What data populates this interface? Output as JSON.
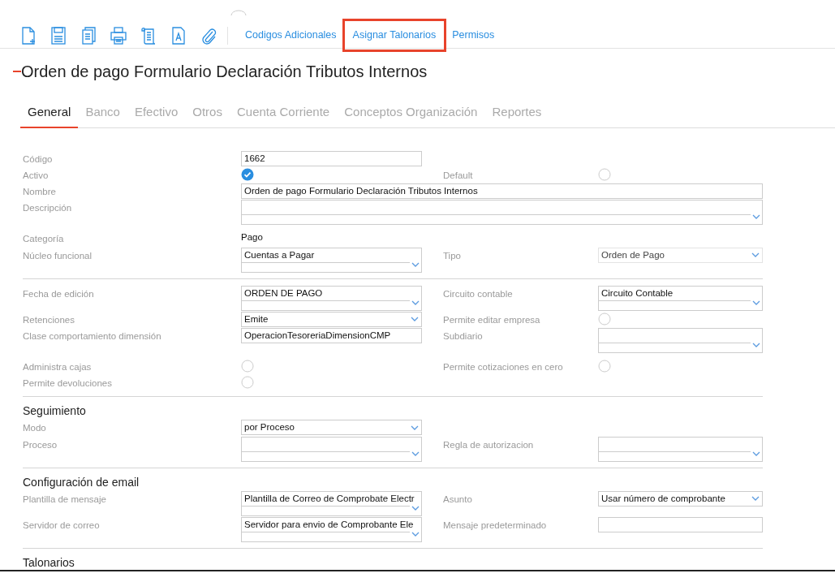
{
  "toolbar": {
    "icons": [
      {
        "kind": "new"
      },
      {
        "kind": "save"
      },
      {
        "kind": "copy"
      },
      {
        "kind": "print"
      },
      {
        "kind": "scroll"
      },
      {
        "kind": "font"
      },
      {
        "kind": "attach"
      }
    ],
    "links": [
      {
        "label": "Codigos Adicionales",
        "highlighted": false
      },
      {
        "label": "Asignar Talonarios",
        "highlighted": true
      },
      {
        "label": "Permisos",
        "highlighted": false
      }
    ]
  },
  "title": "Orden de pago Formulario Declaración Tributos Internos",
  "tabs": [
    {
      "label": "General",
      "selected": true
    },
    {
      "label": "Banco",
      "selected": false
    },
    {
      "label": "Efectivo",
      "selected": false
    },
    {
      "label": "Otros",
      "selected": false
    },
    {
      "label": "Cuenta Corriente",
      "selected": false
    },
    {
      "label": "Conceptos Organización",
      "selected": false
    },
    {
      "label": "Reportes",
      "selected": false
    }
  ],
  "sections": [
    {
      "blocks": [
        [
          {
            "left": {
              "label": "Código",
              "field": {
                "kind": "text",
                "value": "1662"
              }
            }
          },
          {
            "left": {
              "label": "Activo",
              "field": {
                "kind": "check",
                "checked": true
              }
            },
            "right": {
              "label": "Default",
              "field": {
                "kind": "check",
                "checked": false
              }
            }
          },
          {
            "full": {
              "label": "Nombre",
              "field": {
                "kind": "text",
                "value": "Orden de pago Formulario Declaración Tributos Internos"
              }
            }
          },
          {
            "full": {
              "label": "Descripción",
              "field": {
                "kind": "dropdown"
              }
            }
          }
        ],
        [
          {
            "left": {
              "label": "Categoría",
              "field": {
                "kind": "static",
                "value": "Pago"
              }
            }
          },
          {
            "left": {
              "label": "Núcleo funcional",
              "field": {
                "kind": "dropdown",
                "value": "Cuentas a Pagar"
              }
            },
            "right": {
              "label": "Tipo",
              "field": {
                "kind": "select",
                "value": "Orden de Pago",
                "disabled": true
              }
            }
          }
        ]
      ]
    },
    {
      "blocks": [
        [
          {
            "left": {
              "label": "Fecha de edición",
              "field": {
                "kind": "dropdown",
                "value": "ORDEN DE PAGO"
              }
            },
            "right": {
              "label": "Circuito contable",
              "field": {
                "kind": "dropdown",
                "value": "Circuito Contable"
              }
            }
          },
          {
            "left": {
              "label": "Retenciones",
              "field": {
                "kind": "select",
                "value": "Emite",
                "disabled": false
              }
            },
            "right": {
              "label": "Permite editar empresa",
              "field": {
                "kind": "check",
                "checked": false
              }
            }
          },
          {
            "left": {
              "label": "Clase comportamiento dimensión",
              "field": {
                "kind": "text",
                "value": "OperacionTesoreriaDimensionCMP"
              }
            },
            "right": {
              "label": "Subdiario",
              "field": {
                "kind": "dropdown"
              }
            }
          }
        ],
        [
          {
            "left": {
              "label": "Administra cajas",
              "field": {
                "kind": "check",
                "checked": false
              }
            },
            "right": {
              "label": "Permite cotizaciones en cero",
              "field": {
                "kind": "check",
                "checked": false
              }
            }
          },
          {
            "left": {
              "label": "Permite devoluciones",
              "field": {
                "kind": "check",
                "checked": false
              }
            }
          }
        ]
      ]
    },
    {
      "heading": "Seguimiento",
      "blocks": [
        [
          {
            "left": {
              "label": "Modo",
              "field": {
                "kind": "select",
                "value": "por Proceso",
                "disabled": false
              }
            }
          },
          {
            "left": {
              "label": "Proceso",
              "field": {
                "kind": "dropdown"
              }
            },
            "right": {
              "label": "Regla de autorizacion",
              "field": {
                "kind": "dropdown"
              }
            }
          }
        ]
      ]
    },
    {
      "heading": "Configuración de email",
      "blocks": [
        [
          {
            "left": {
              "label": "Plantilla de mensaje",
              "field": {
                "kind": "dropdown",
                "value": "Plantilla de Correo de Comprobate Electr"
              }
            },
            "right": {
              "label": "Asunto",
              "field": {
                "kind": "select",
                "value": "Usar número de comprobante",
                "disabled": false
              }
            }
          },
          {
            "left": {
              "label": "Servidor de correo",
              "field": {
                "kind": "dropdown",
                "value": "Servidor para envio de Comprobante Ele"
              }
            },
            "right": {
              "label": "Mensaje predeterminado",
              "field": {
                "kind": "text"
              }
            }
          }
        ]
      ]
    },
    {
      "heading": "Talonarios"
    }
  ]
}
